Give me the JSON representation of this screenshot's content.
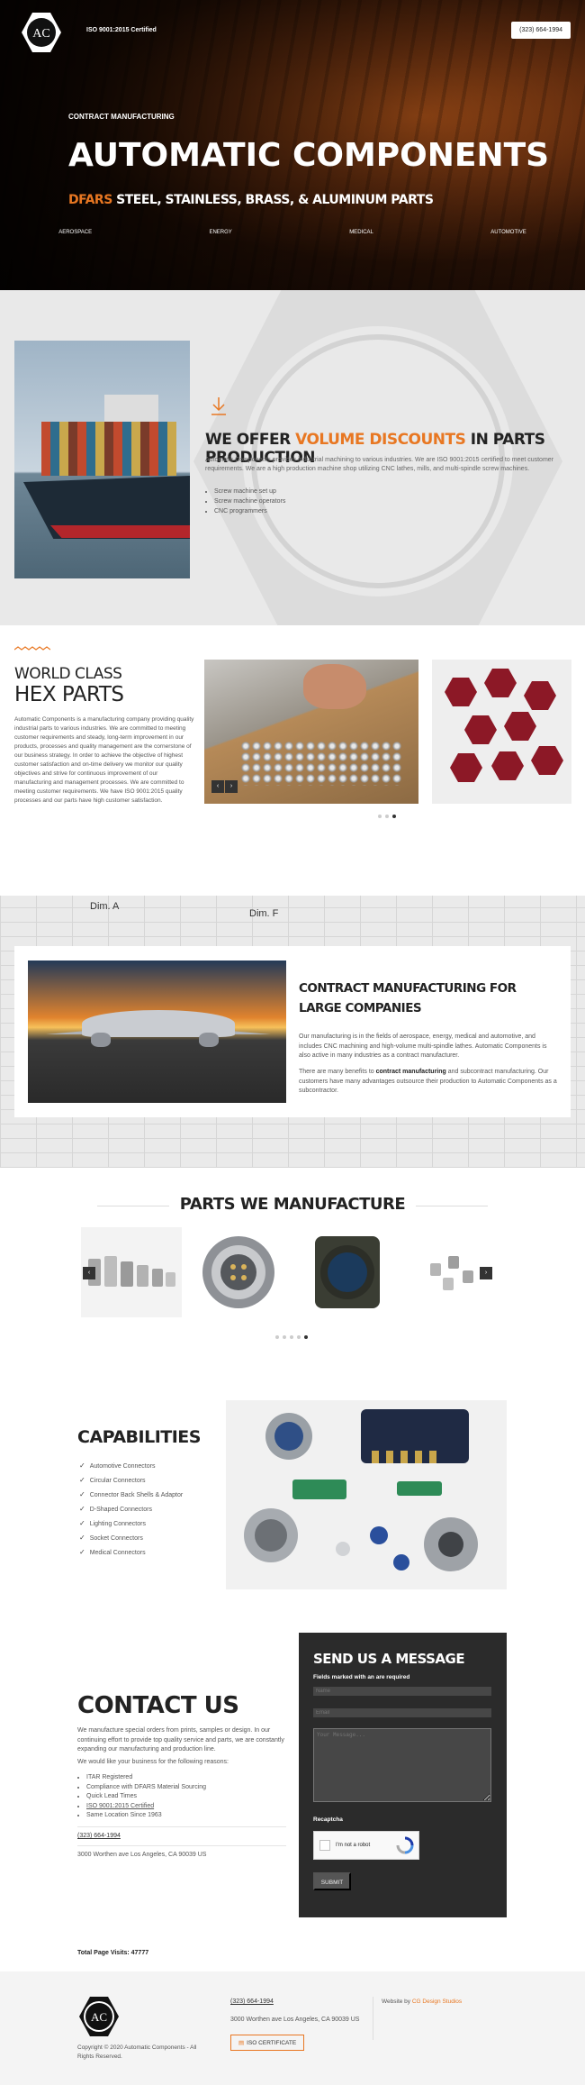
{
  "header": {
    "iso_text": "ISO 9001:2015 Certified",
    "phone": "(323) 664-1994"
  },
  "hero": {
    "kicker": "CONTRACT MANUFACTURING",
    "title": "AUTOMATIC COMPONENTS",
    "sub_accent": "DFARS",
    "sub_rest": "STEEL, STAINLESS, BRASS, & ALUMINUM PARTS",
    "nav": [
      "AEROSPACE",
      "ENERGY",
      "MEDICAL",
      "AUTOMOTIVE"
    ]
  },
  "offer": {
    "title_pre": "WE OFFER",
    "title_accent": "VOLUME DISCOUNTS",
    "title_post": "IN PARTS PRODUCTION",
    "text": "Automatic Components provides industrial machining to various industries. We are ISO 9001:2015 certified to meet customer requirements. We are a high production machine shop utilizing CNC lathes, mills, and multi-spindle screw machines.",
    "list": [
      "Screw machine set up",
      "Screw machine operators",
      "CNC programmers"
    ]
  },
  "hexparts": {
    "title1": "WORLD CLASS",
    "title2": "HEX PARTS",
    "text": "Automatic Components is a manufacturing company providing quality industrial parts to various industries. We are committed to meeting customer requirements and steady, long-term improvement in our products, processes and quality management are the cornerstone of our business strategy. In order to achieve the objective of highest customer satisfaction and on-time delivery we monitor our quality objectives and strive for continuous improvement of our manufacturing and management processes. We are committed to meeting customer requirements. We have ISO 9001:2015 quality processes and our parts have high customer satisfaction."
  },
  "contract": {
    "bg_label_a": "Dim. A",
    "bg_label_f": "Dim. F",
    "title": "CONTRACT MANUFACTURING FOR LARGE COMPANIES",
    "p1": "Our manufacturing is in the fields of aerospace, energy, medical and automotive, and includes CNC machining and high-volume multi-spindle lathes. Automatic Components is also active in many industries as a contract manufacturer.",
    "p2_pre": "There are many benefits to",
    "p2_bold": "contract manufacturing",
    "p2_post": "and subcontract manufacturing. Our customers have many advantages outsource their production to Automatic Components as a subcontractor."
  },
  "parts": {
    "title": "PARTS WE MANUFACTURE"
  },
  "capabilities": {
    "title": "CAPABILITIES",
    "items": [
      "Automotive Connectors",
      "Circular Connectors",
      "Connector Back Shells & Adaptor",
      "D-Shaped Connectors",
      "Lighting Connectors",
      "Socket Connectors",
      "Medical Connectors"
    ]
  },
  "contact": {
    "title": "CONTACT US",
    "p1": "We manufacture special orders from prints, samples or design. In our continuing effort to provide top quality service and parts, we are constantly expanding our manufacturing and production line.",
    "p2": "We would like your business for the following reasons:",
    "reasons": [
      "ITAR Registered",
      "Compliance with DFARS Material Sourcing",
      "Quick Lead Times",
      "ISO 9001:2015 Certified",
      "Same Location Since 1963"
    ],
    "phone": "(323) 664-1994",
    "address": "3000 Worthen ave Los Angeles, CA 90039 US",
    "visits": "Total Page Visits: 47777"
  },
  "form": {
    "title": "SEND US A MESSAGE",
    "required_note": "Fields marked with an   are required",
    "name_placeholder": "Name",
    "email_placeholder": "Email",
    "message_placeholder": "Your Message...",
    "recaptcha_label": "Recaptcha",
    "captcha_text": "I'm not a robot",
    "submit": "SUBMIT"
  },
  "footer": {
    "copyright": "Copyright © 2020 Automatic Components - All Rights Reserved.",
    "phone": "(323) 664-1994",
    "address": "3000 Worthen ave Los Angeles, CA 90039 US",
    "cert_button": "ISO CERTIFICATE",
    "website_pre": "Website by",
    "website_link": "CG Design Studios"
  },
  "colors": {
    "accent": "#e87722",
    "dark": "#2b2b2b"
  }
}
